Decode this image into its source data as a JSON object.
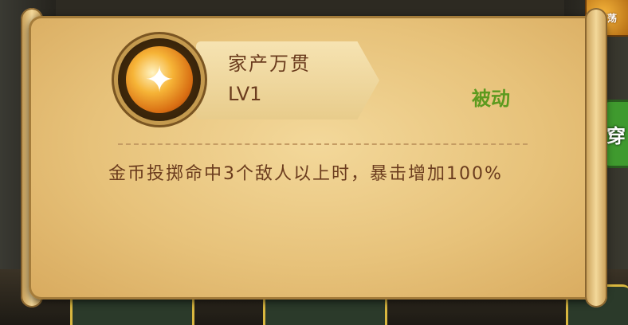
{
  "skill": {
    "name": "家产万贯",
    "level": "LV1",
    "type": "被动",
    "description": "金币投掷命中3个敌人以上时，暴击增加100%",
    "icon": "coin-blast-icon"
  },
  "background": {
    "badge_label": "扫荡",
    "side_button_label": "穿"
  },
  "colors": {
    "text_brown": "#6b3c1e",
    "passive_green": "#5c9a1e",
    "scroll": "#e7c27a"
  }
}
